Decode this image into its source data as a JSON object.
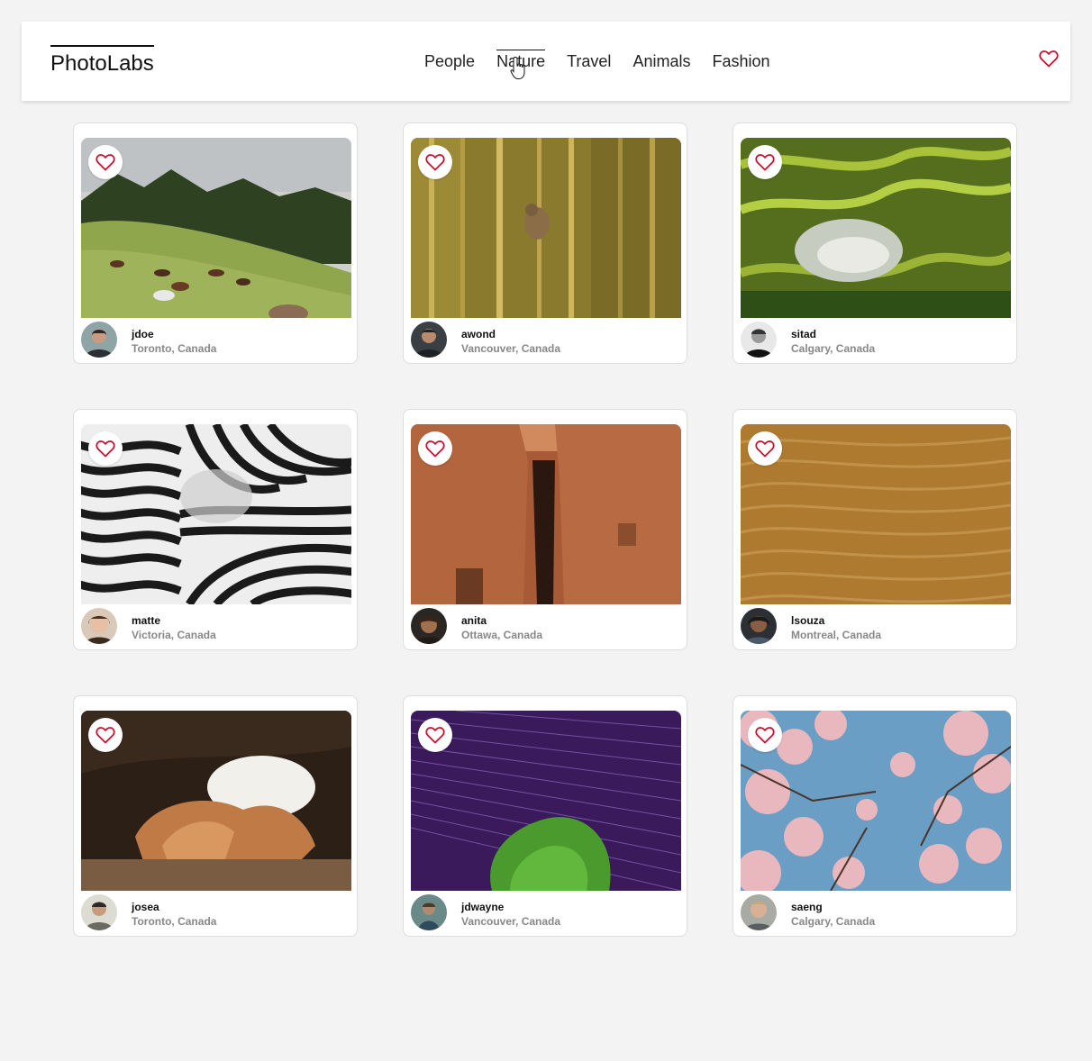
{
  "nav": {
    "logo": "PhotoLabs",
    "topics": [
      "People",
      "Nature",
      "Travel",
      "Animals",
      "Fashion"
    ],
    "active_topic": "Nature",
    "favorite_icon": "heart-outline-icon",
    "accent": "#c8102e"
  },
  "photos": [
    {
      "username": "jdoe",
      "location": "Toronto, Canada",
      "scene": "hills-horses"
    },
    {
      "username": "awond",
      "location": "Vancouver, Canada",
      "scene": "bird-reeds"
    },
    {
      "username": "sitad",
      "location": "Calgary, Canada",
      "scene": "rice-terraces"
    },
    {
      "username": "matte",
      "location": "Victoria, Canada",
      "scene": "zebra"
    },
    {
      "username": "anita",
      "location": "Ottawa, Canada",
      "scene": "canyon"
    },
    {
      "username": "lsouza",
      "location": "Montreal, Canada",
      "scene": "sand-dunes"
    },
    {
      "username": "josea",
      "location": "Toronto, Canada",
      "scene": "cave"
    },
    {
      "username": "jdwayne",
      "location": "Vancouver, Canada",
      "scene": "star-trails"
    },
    {
      "username": "saeng",
      "location": "Calgary, Canada",
      "scene": "cherry-blossom"
    }
  ]
}
